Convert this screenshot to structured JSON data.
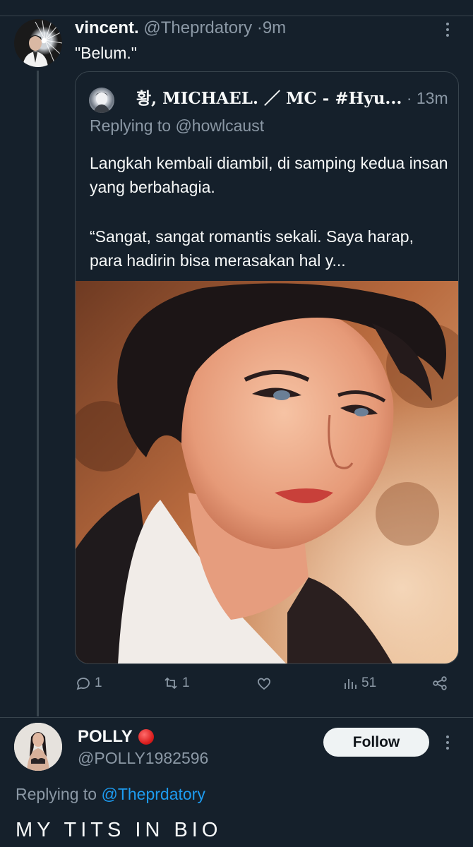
{
  "tweet": {
    "author_name": "vincent.",
    "author_handle": "@Theprdatory",
    "separator": "·",
    "time": "9m",
    "text": "\"Belum.\"",
    "quote": {
      "author_name": "황, MICHAEL. ／ MC - #Hyu...",
      "separator": "·",
      "time": "13m",
      "replying_to": "Replying to @howlcaust",
      "paragraphs": [
        "Langkah kembali diambil, di samping kedua insan yang berbahagia.",
        "“Sangat, sangat romantis sekali. Saya harap, para hadirin bisa merasakan hal y..."
      ]
    },
    "actions": {
      "replies": "1",
      "retweets": "1",
      "likes": "",
      "views": "51"
    }
  },
  "reply": {
    "author_name": "POLLY",
    "author_handle": "@POLLY1982596",
    "follow_label": "Follow",
    "replying_prefix": "Replying to",
    "replying_mention": "@Theprdatory",
    "text": "MY TITS IN BIO"
  },
  "colors": {
    "background": "#15202b",
    "border": "#38444d",
    "muted_text": "#8b98a5",
    "primary_text": "#f7f9f9",
    "link": "#1d9bf0",
    "follow_button_bg": "#eff3f4"
  },
  "icons": [
    "more-icon",
    "reply-icon",
    "retweet-icon",
    "like-icon",
    "views-icon",
    "share-icon"
  ]
}
